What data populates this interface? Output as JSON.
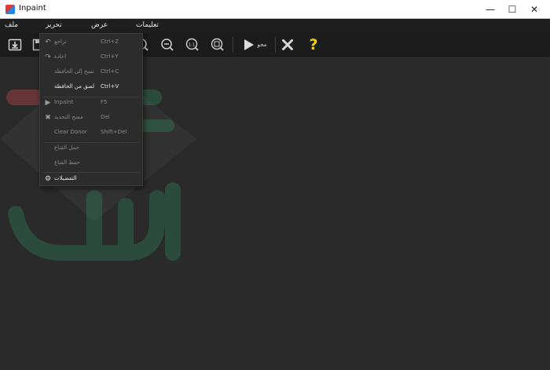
{
  "window": {
    "title": "Inpaint"
  },
  "window_controls": {
    "minimize": "—",
    "maximize": "☐",
    "close": "✕"
  },
  "menubar": {
    "file": "ملف",
    "edit": "تحرير",
    "view": "عرض",
    "help": "تعليمات"
  },
  "toolbar": {
    "erase_label": "محو",
    "help_symbol": "?",
    "zoom_actual_label": "1:1"
  },
  "edit_menu": {
    "items": [
      {
        "label": "تراجع",
        "shortcut": "Ctrl+Z",
        "icon": "undo-icon",
        "enabled": false
      },
      {
        "label": "اعادة",
        "shortcut": "Ctrl+Y",
        "icon": "redo-icon",
        "enabled": false
      },
      {
        "label": "نسخ إلى الحافظة",
        "shortcut": "Ctrl+C",
        "icon": "",
        "enabled": false
      },
      {
        "label": "لصق من الحافظة",
        "shortcut": "Ctrl+V",
        "icon": "",
        "enabled": true
      },
      {
        "label": "Inpaint",
        "shortcut": "F5",
        "icon": "play-icon",
        "enabled": false
      },
      {
        "label": "مسح التحديد",
        "shortcut": "Del",
        "icon": "x-icon",
        "enabled": false
      },
      {
        "label": "Clear Donor",
        "shortcut": "Shift+Del",
        "icon": "",
        "enabled": false
      },
      {
        "label": "حمل القناع",
        "shortcut": "",
        "icon": "",
        "enabled": false
      },
      {
        "label": "حفظ القناع",
        "shortcut": "",
        "icon": "",
        "enabled": false
      },
      {
        "label": "التفضيلات",
        "shortcut": "",
        "icon": "gear-icon",
        "enabled": true
      }
    ]
  },
  "colors": {
    "background": "#2a2a2a",
    "toolbar": "#1c1c1c",
    "menu_bg": "#2c2c2c",
    "help_yellow": "#f5d000",
    "watermark_red": "#d94a4a",
    "watermark_green": "#2f9a6a"
  }
}
